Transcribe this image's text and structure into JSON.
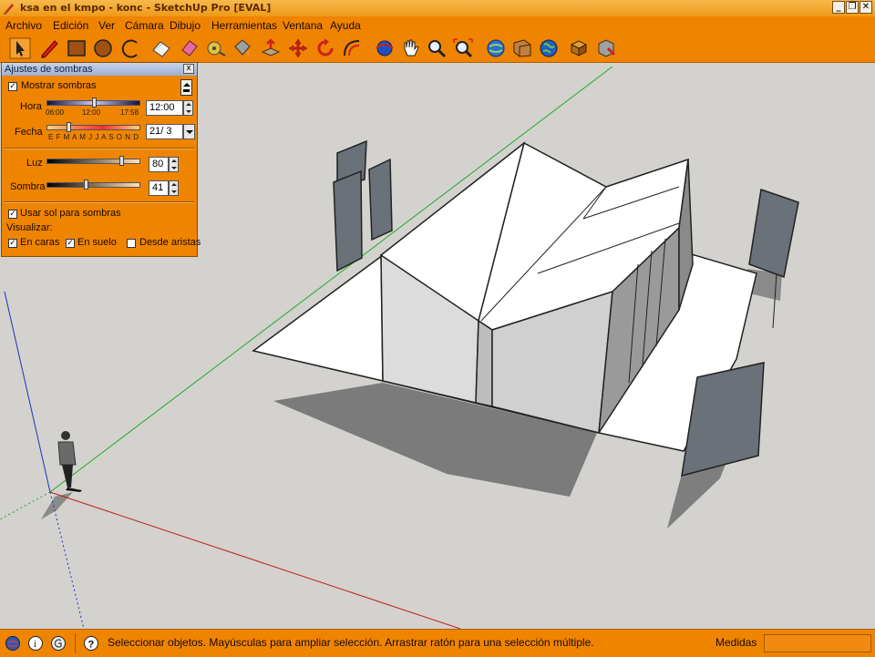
{
  "window": {
    "title": "ksa en el kmpo - konc - SketchUp Pro [EVAL]",
    "buttons": [
      "_",
      "❐",
      "✕"
    ]
  },
  "menu": [
    "Archivo",
    "Edición",
    "Ver",
    "Cámara",
    "Dibujo",
    "Herramientas",
    "Ventana",
    "Ayuda"
  ],
  "toolbar": {
    "tools": [
      "select-icon",
      "pencil-icon",
      "rectangle-icon",
      "circle-icon",
      "arc-icon",
      "eraser-icon",
      "paint-icon",
      "tape-icon",
      "paint-bucket-icon",
      "push-pull-icon",
      "move-icon",
      "rotate-icon",
      "offset-icon",
      "orbit-icon",
      "pan-icon",
      "zoom-icon",
      "zoom-extents-icon",
      "get-models-icon",
      "share-model-icon",
      "google-earth-icon",
      "components-icon",
      "materials-icon"
    ]
  },
  "shadow_panel": {
    "title": "Ajustes de sombras",
    "close": "x",
    "show_shadows": {
      "label": "Mostrar sombras",
      "checked": true
    },
    "time": {
      "label": "Hora",
      "value": "12:00",
      "ticks": [
        "06:00",
        "12:00",
        "17:58"
      ]
    },
    "date": {
      "label": "Fecha",
      "value": "21/ 3",
      "months": "E F M A M J J A S O N D"
    },
    "light": {
      "label": "Luz",
      "value": "80"
    },
    "shade": {
      "label": "Sombra",
      "value": "41"
    },
    "use_sun": {
      "label": "Usar sol para sombras",
      "checked": true
    },
    "display_label": "Visualizar:",
    "on_faces": {
      "label": "En caras",
      "checked": true
    },
    "on_ground": {
      "label": "En suelo",
      "checked": true
    },
    "from_edges": {
      "label": "Desde aristas",
      "checked": false
    }
  },
  "status": {
    "text": "Seleccionar objetos. Mayúsculas para ampliar selección. Arrastrar ratón para una selección múltiple.",
    "measures_label": "Medidas",
    "measures_value": ""
  },
  "colors": {
    "accent": "#ef8400",
    "viewport": "#d3d2ce",
    "axis_red": "#c02020",
    "axis_green": "#22aa22",
    "axis_blue": "#2030c0"
  }
}
